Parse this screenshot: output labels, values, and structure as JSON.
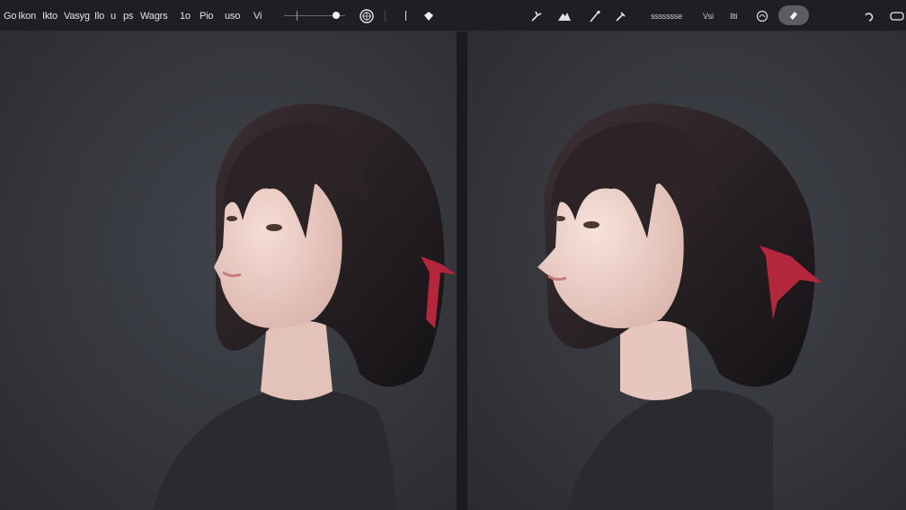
{
  "toolbar": {
    "gallery_label": "Go",
    "menu": [
      "Ikon",
      "Ikto",
      "Vasyg",
      "Ilo",
      "u",
      "ps",
      "Wagrs",
      "1o",
      "Pio",
      "uso",
      "Vi"
    ],
    "brush_label": "ssssssse",
    "layer_labels": [
      "Vsi",
      "Ilti"
    ]
  },
  "icons": {
    "adjust": "magic-wand-icon",
    "selection": "selection-icon",
    "transform": "arrow-cursor-icon",
    "brush": "brush-icon",
    "smudge": "smudge-icon",
    "eraser": "eraser-icon",
    "layers": "layers-icon",
    "color": "color-swatch-icon",
    "texture": "texture-icon",
    "undo": "undo-icon",
    "window": "window-icon"
  },
  "colors": {
    "toolbar_bg": "#1e1f23",
    "canvas_bg": "#35373d",
    "active_tool": "#5b5d63",
    "ribbon": "#b3263b"
  }
}
